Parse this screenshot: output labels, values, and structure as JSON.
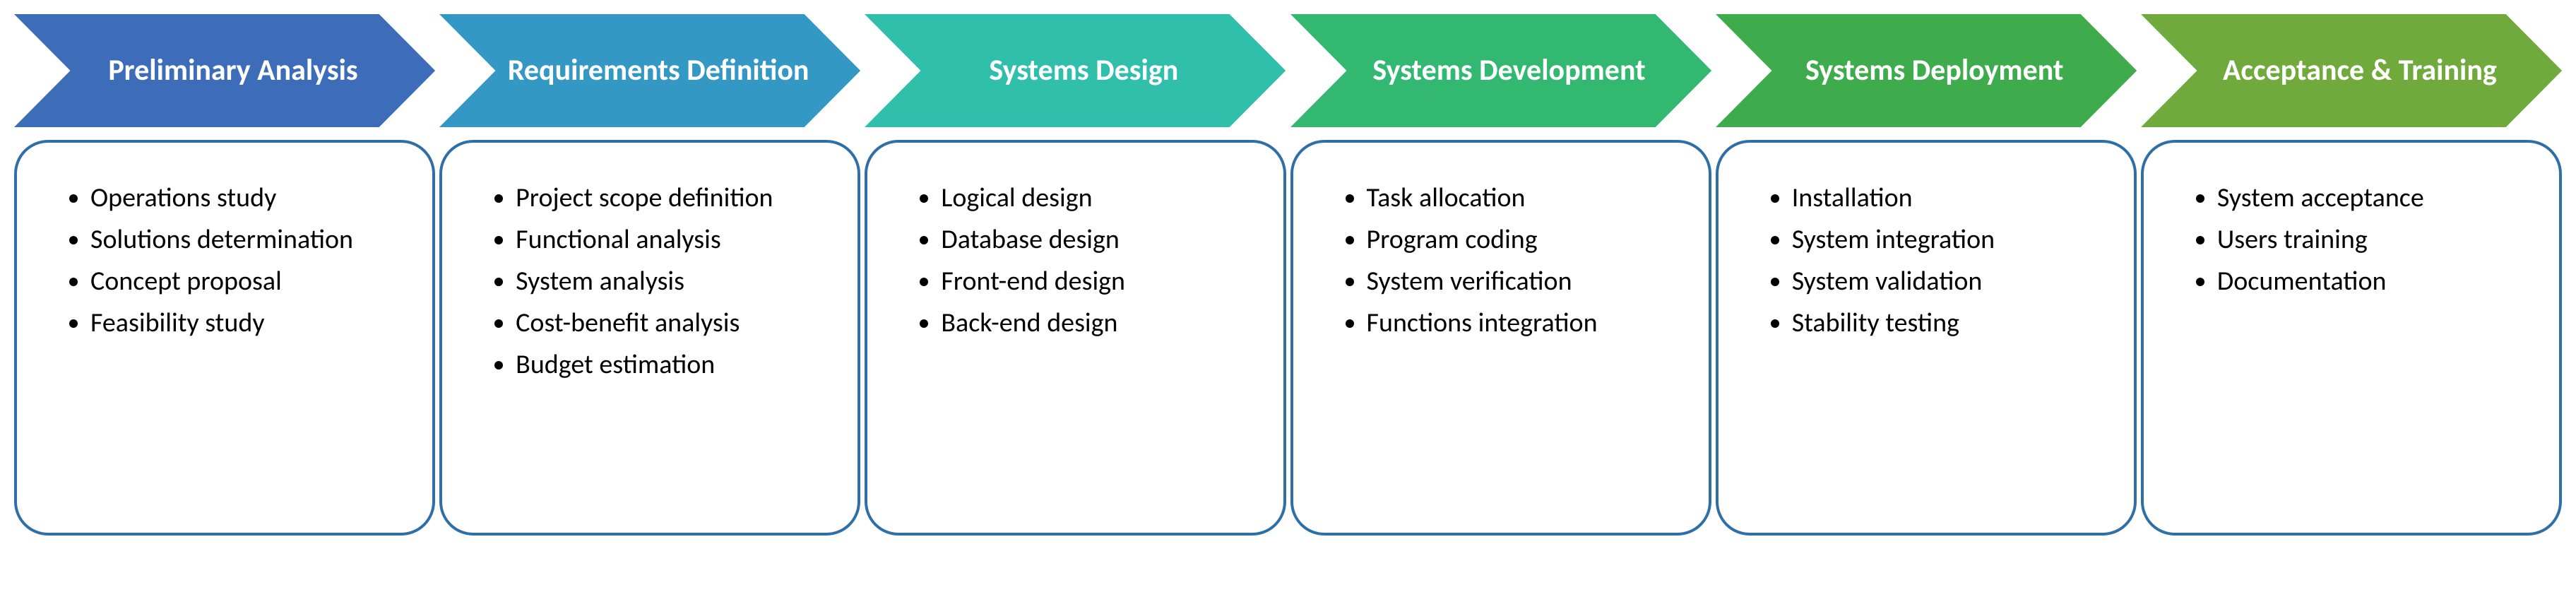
{
  "diagram": {
    "type": "process-flow",
    "border_color": "#2f6fa8",
    "stages": [
      {
        "title": "Preliminary Analysis",
        "color": "#3d6db8",
        "text_color": "#ffffff",
        "items": [
          "Operations study",
          "Solutions determination",
          "Concept proposal",
          "Feasibility study"
        ]
      },
      {
        "title": "Requirements Definition",
        "color": "#3398c3",
        "text_color": "#ffffff",
        "items": [
          "Project scope definition",
          "Functional analysis",
          "System analysis",
          "Cost-benefit analysis",
          "Budget estimation"
        ]
      },
      {
        "title": "Systems Design",
        "color": "#2fbfaa",
        "text_color": "#ffffff",
        "items": [
          "Logical design",
          "Database design",
          "Front-end design",
          "Back-end design"
        ]
      },
      {
        "title": "Systems Development",
        "color": "#33b872",
        "text_color": "#ffffff",
        "items": [
          "Task allocation",
          "Program coding",
          "System verification",
          "Functions integration"
        ]
      },
      {
        "title": "Systems Deployment",
        "color": "#3eab4c",
        "text_color": "#ffffff",
        "items": [
          "Installation",
          "System integration",
          "System validation",
          "Stability testing"
        ]
      },
      {
        "title": "Acceptance & Training",
        "color": "#70aa3c",
        "text_color": "#ffffff",
        "items": [
          "System acceptance",
          "Users training",
          "Documentation"
        ]
      }
    ]
  }
}
